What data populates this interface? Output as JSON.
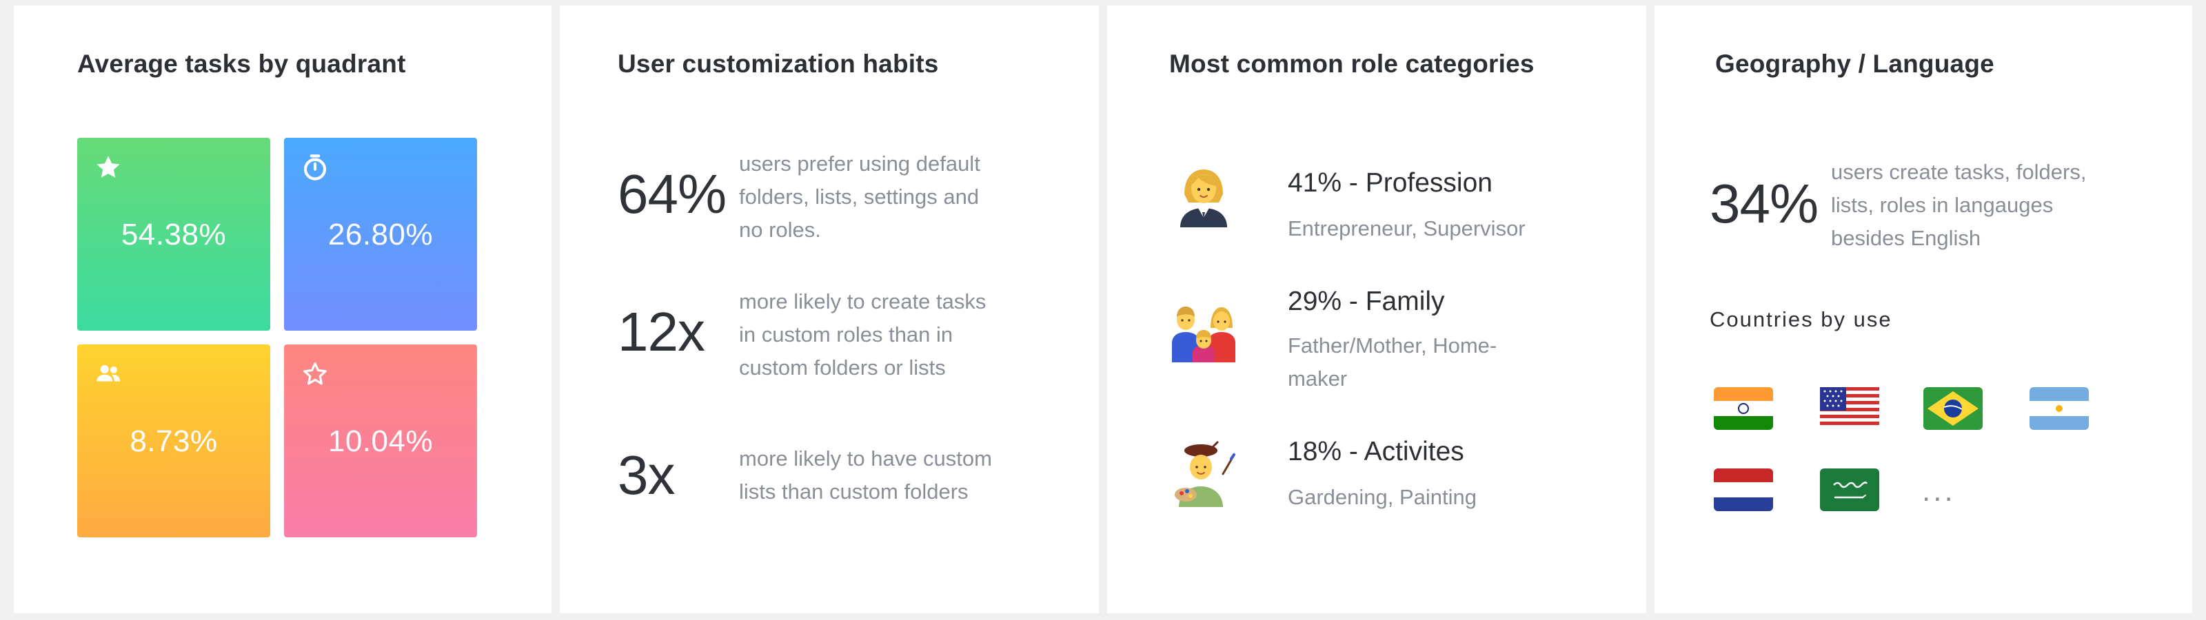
{
  "quadrants": {
    "title": "Average tasks by quadrant",
    "tiles": [
      {
        "icon": "star-filled-icon",
        "value": "54.38%"
      },
      {
        "icon": "stopwatch-icon",
        "value": "26.80%"
      },
      {
        "icon": "people-icon",
        "value": "8.73%"
      },
      {
        "icon": "star-outline-icon",
        "value": "10.04%"
      }
    ]
  },
  "customization": {
    "title": "User customization habits",
    "stats": [
      {
        "value": "64%",
        "desc": [
          "users prefer using default",
          "folders, lists, settings and",
          "no roles."
        ]
      },
      {
        "value": "12x",
        "desc": [
          "more likely to create tasks",
          "in custom roles than in",
          "custom folders or lists"
        ]
      },
      {
        "value": "3x",
        "desc": [
          "more likely to have custom",
          "lists than custom folders"
        ]
      }
    ]
  },
  "roles": {
    "title": "Most common role categories",
    "items": [
      {
        "icon": "businesswoman-emoji-icon",
        "title": "41% - Profession",
        "sub": [
          "Entrepreneur, Supervisor"
        ]
      },
      {
        "icon": "family-emoji-icon",
        "title": "29% - Family",
        "sub": [
          "Father/Mother, Home-",
          "maker"
        ]
      },
      {
        "icon": "artist-emoji-icon",
        "title": "18% - Activites",
        "sub": [
          "Gardening, Painting"
        ]
      }
    ]
  },
  "geography": {
    "title": "Geography / Language",
    "stat": {
      "value": "34%",
      "desc": [
        "users create tasks, folders,",
        "lists, roles in langauges",
        "besides English"
      ]
    },
    "countries_label": "Countries by use",
    "flags": [
      "india-flag-icon",
      "usa-flag-icon",
      "brazil-flag-icon",
      "argentina-flag-icon",
      "netherlands-flag-icon",
      "saudi-arabia-flag-icon"
    ],
    "more": "..."
  },
  "colors": {
    "tile_green": [
      "#67db78",
      "#3ddba0"
    ],
    "tile_blue": [
      "#4aa9fb",
      "#738eff"
    ],
    "tile_yellow": [
      "#fed32f",
      "#feaa42"
    ],
    "tile_pink": [
      "#fd8680",
      "#f97eaa"
    ],
    "text_dark": "#2c2f34",
    "text_muted": "#8a8f97"
  }
}
